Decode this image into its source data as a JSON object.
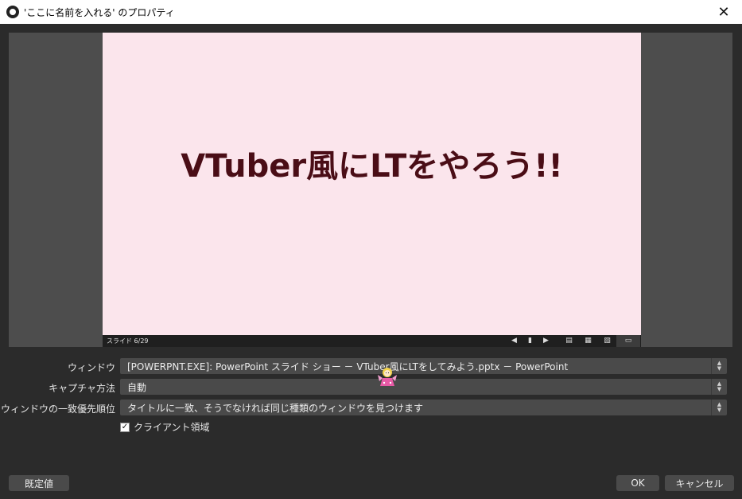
{
  "window": {
    "title": "'ここに名前を入れる' のプロパティ",
    "close_glyph": "✕"
  },
  "preview": {
    "slide_title": "VTuber風にLTをやろう!!",
    "slide_counter": "スライド 6/29",
    "slide_bg_color": "#fbe5ec",
    "slide_text_color": "#4a0d16",
    "controls": [
      "prev-icon",
      "pen-icon",
      "next-icon",
      "normal-view-icon",
      "slide-sorter-icon",
      "reading-view-icon",
      "slideshow-icon"
    ]
  },
  "form": {
    "window_label": "ウィンドウ",
    "window_value": "[POWERPNT.EXE]: PowerPoint スライド ショー － VTuber風にLTをしてみよう.pptx － PowerPoint",
    "capture_label": "キャプチャ方法",
    "capture_value": "自動",
    "priority_label": "ウィンドウの一致優先順位",
    "priority_value": "タイトルに一致、そうでなければ同じ種類のウィンドウを見つけます",
    "client_area_label": "クライアント領域",
    "client_area_checked": true
  },
  "buttons": {
    "defaults": "既定値",
    "ok": "OK",
    "cancel": "キャンセル"
  }
}
